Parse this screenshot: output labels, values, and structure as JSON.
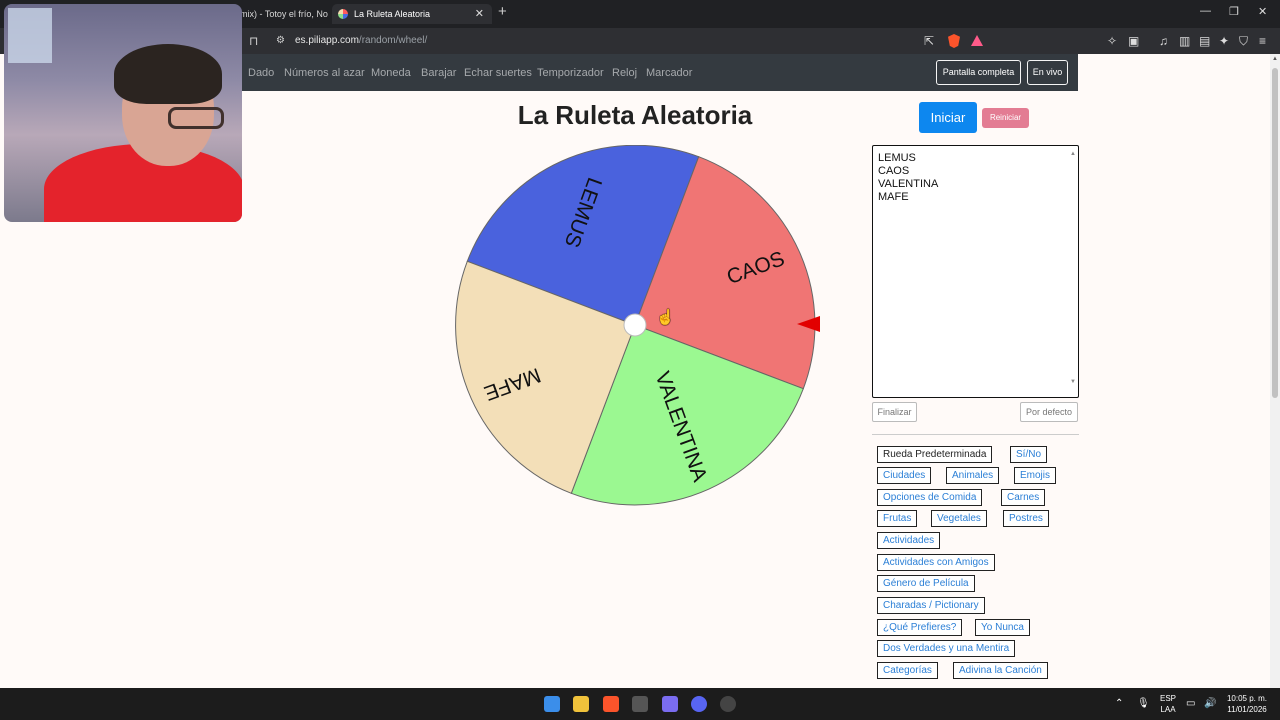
{
  "browser": {
    "prev_tab_title": "mix) - Totoy el frío, No",
    "active_tab_title": "La Ruleta Aleatoria",
    "url_domain": "es.piliapp.com",
    "url_path": "/random/wheel/"
  },
  "nav": {
    "links": [
      "Dado",
      "Números al azar",
      "Moneda",
      "Barajar",
      "Echar suertes",
      "Temporizador",
      "Reloj",
      "Marcador"
    ],
    "fullscreen_label": "Pantalla completa",
    "live_label": "En vivo"
  },
  "page": {
    "title": "La Ruleta Aleatoria",
    "start_label": "Iniciar",
    "reset_label": "Reiniciar",
    "finish_label": "Finalizar",
    "default_label": "Por defecto"
  },
  "wheel": {
    "segments": [
      {
        "label": "LEMUS",
        "color": "#4a62dd"
      },
      {
        "label": "CAOS",
        "color": "#f07574"
      },
      {
        "label": "VALENTINA",
        "color": "#9bf891"
      },
      {
        "label": "MAFE",
        "color": "#f3dfb8"
      }
    ],
    "pointer_color": "#e20000"
  },
  "names": [
    "LEMUS",
    "CAOS",
    "VALENTINA",
    "MAFE"
  ],
  "presets": [
    "Rueda Predeterminada",
    "Sí/No",
    "Ciudades",
    "Animales",
    "Emojis",
    "Opciones de Comida",
    "Carnes",
    "Frutas",
    "Vegetales",
    "Postres",
    "Actividades",
    "Actividades con Amigos",
    "Género de Película",
    "Charadas / Pictionary",
    "¿Qué Prefieres?",
    "Yo Nunca",
    "Dos Verdades y una Mentira",
    "Categorías",
    "Adivina la Canción"
  ],
  "taskbar": {
    "lang_top": "ESP",
    "lang_bottom": "LAA",
    "time": "10:05 p. m.",
    "date": "11/01/2026"
  }
}
